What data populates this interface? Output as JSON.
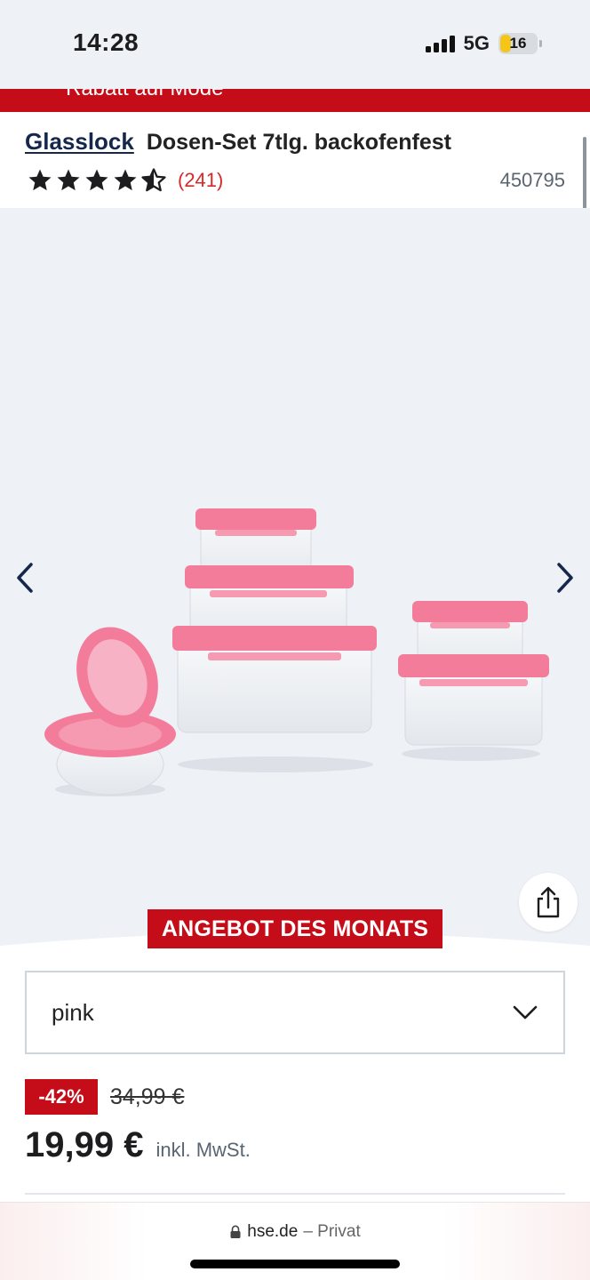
{
  "status_bar": {
    "time": "14:28",
    "network": "5G",
    "battery_level": "16",
    "battery_color": "#f5c518"
  },
  "promo": {
    "text": "Rabatt auf Mode"
  },
  "product": {
    "brand": "Glasslock",
    "title": "Dosen-Set 7tlg. backofenfest",
    "rating": 4.5,
    "rating_max": 5,
    "review_count": "(241)",
    "article_number": "450795"
  },
  "gallery": {
    "prev_icon": "chevron-left-icon",
    "next_icon": "chevron-right-icon",
    "share_icon": "share-icon",
    "image_subject": "pink-lid-glass-containers"
  },
  "offer": {
    "badge": "ANGEBOT DES MONATS"
  },
  "variant": {
    "selected": "pink",
    "dropdown_icon": "chevron-down-icon"
  },
  "pricing": {
    "discount": "-42%",
    "old_price": "34,99 €",
    "price": "19,99 €",
    "tax_note": "inkl. MwSt."
  },
  "browser": {
    "host": "hse.de",
    "mode": "– Privat"
  },
  "colors": {
    "brand_red": "#c40d19",
    "brand_navy": "#15284b",
    "review_red": "#d42a2a",
    "lid_pink": "#f27c9a"
  }
}
